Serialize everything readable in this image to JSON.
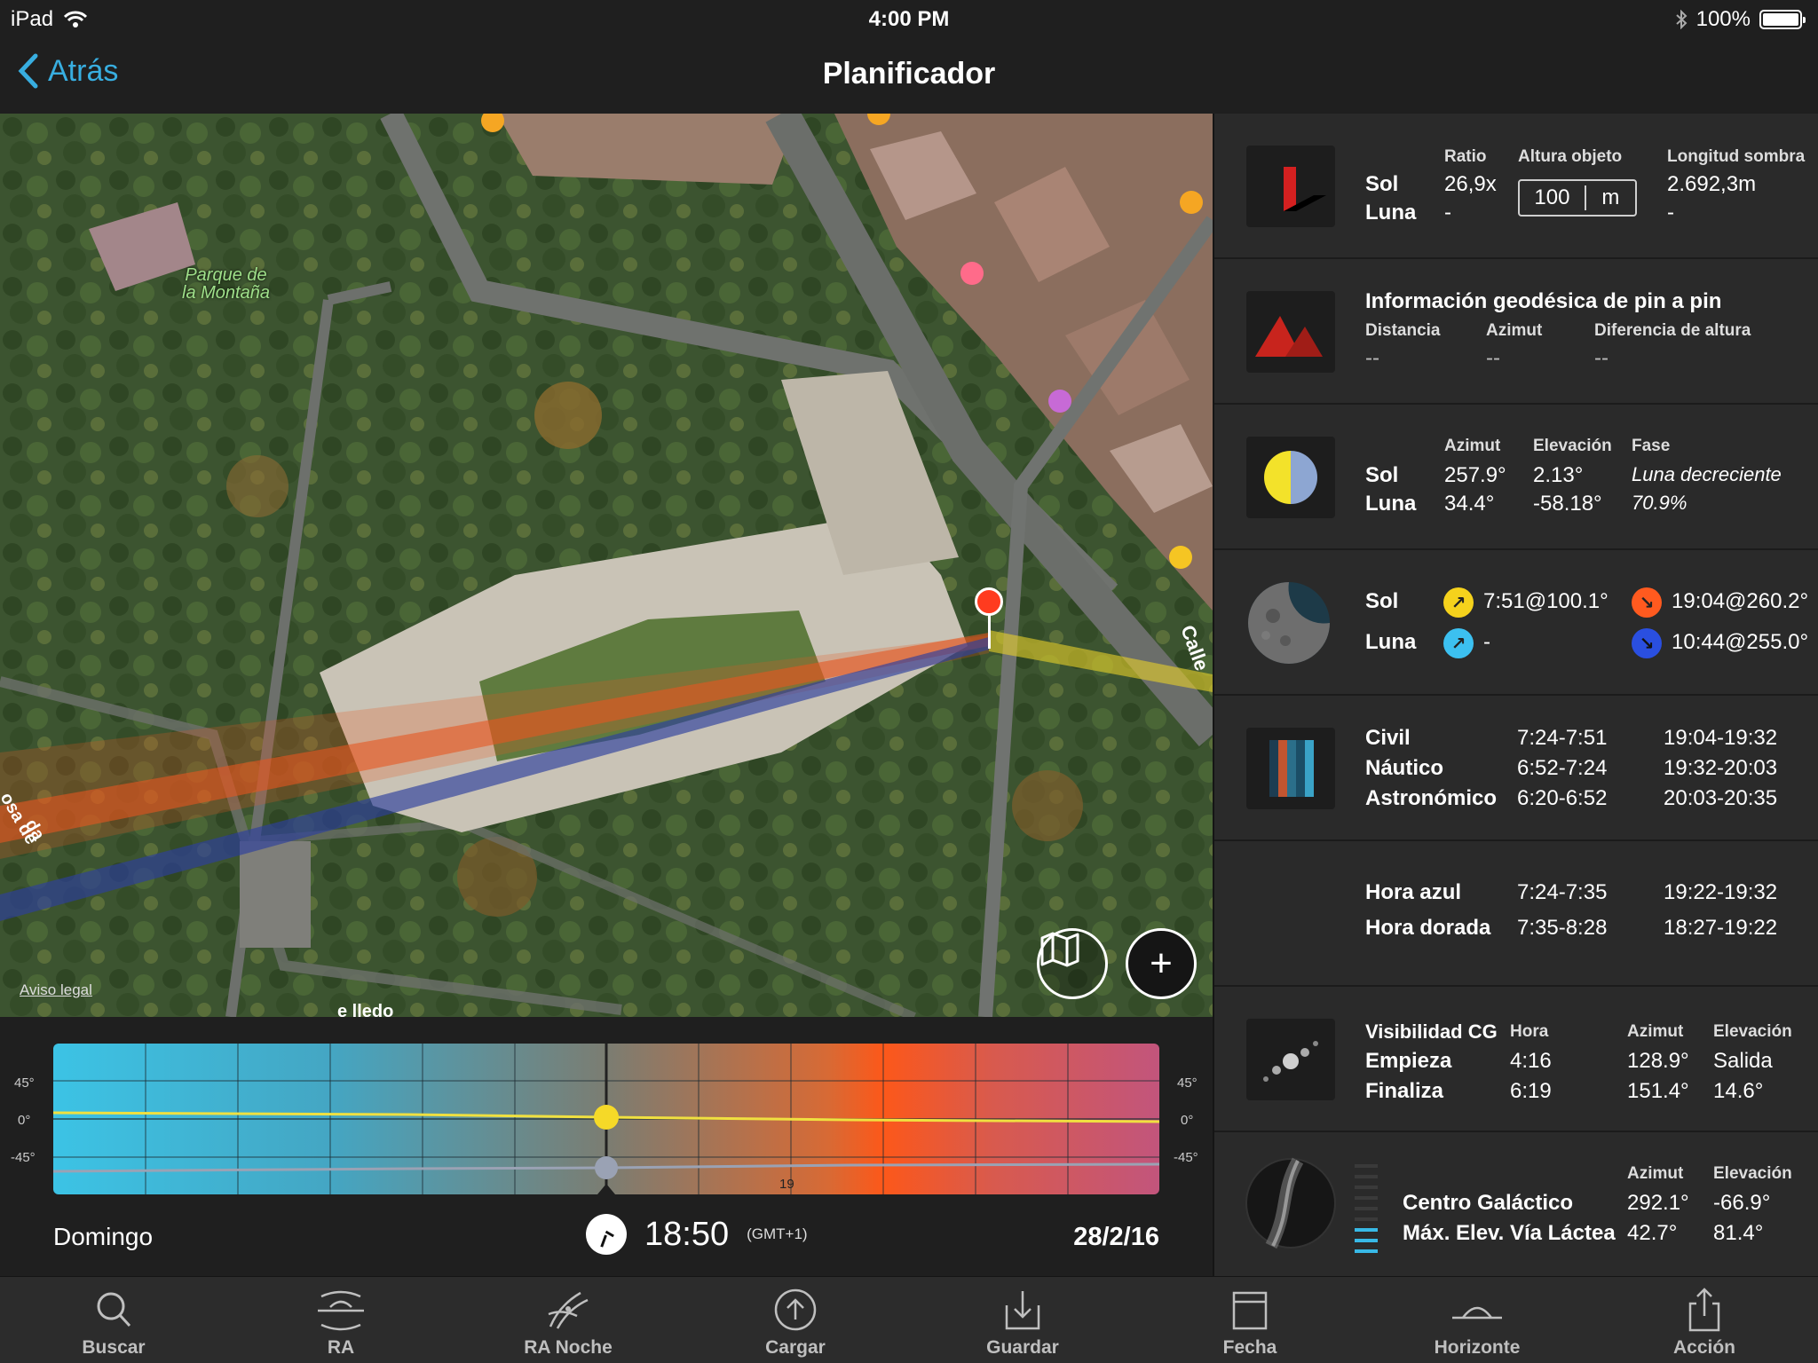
{
  "status": {
    "device": "iPad",
    "time": "4:00 PM",
    "battery": "100%"
  },
  "nav": {
    "back_label": "Atrás",
    "title": "Planificador"
  },
  "map": {
    "park_label_1": "Parque de",
    "park_label_2": "la Montaña",
    "legal": "Aviso legal",
    "street_1": "Calle",
    "street_2": "osa de",
    "street_3": "da",
    "street_4": "e lledo"
  },
  "timeline": {
    "axis": [
      "45°",
      "0°",
      "-45°"
    ],
    "hour_tick": "19",
    "day": "Domingo",
    "time": "18:50",
    "tz": "(GMT+1)",
    "date": "28/2/16",
    "cursor_fraction": 0.5
  },
  "shadow": {
    "sun": "Sol",
    "moon": "Luna",
    "ratio_h": "Ratio",
    "ratio_sun": "26,9x",
    "ratio_moon": "-",
    "height_h": "Altura objeto",
    "height_value": "100",
    "height_unit": "m",
    "length_h": "Longitud sombra",
    "length_sun": "2.692,3m",
    "length_moon": "-"
  },
  "geodesic": {
    "title": "Información geodésica de pin a pin",
    "distance_h": "Distancia",
    "azimuth_h": "Azimut",
    "height_diff_h": "Diferencia de altura",
    "distance": "--",
    "azimuth": "--",
    "height_diff": "--"
  },
  "position": {
    "sun": "Sol",
    "moon": "Luna",
    "azimuth_h": "Azimut",
    "elev_h": "Elevación",
    "phase_h": "Fase",
    "sun_az": "257.9°",
    "sun_el": "2.13°",
    "phase_name": "Luna decreciente",
    "moon_az": "34.4°",
    "moon_el": "-58.18°",
    "phase_pct": "70.9%"
  },
  "rise_set": {
    "sun": "Sol",
    "moon": "Luna",
    "sun_rise": "7:51@100.1°",
    "sun_set": "19:04@260.2°",
    "moon_rise": "-",
    "moon_set": "10:44@255.0°",
    "colors": {
      "sun_rise": "#f5d21c",
      "sun_set": "#ff5a1f",
      "moon_rise": "#3cc0f0",
      "moon_set": "#2a4fe0"
    }
  },
  "twilight": {
    "civil": "Civil",
    "nautical": "Náutico",
    "astro": "Astronómico",
    "civil_am": "7:24-7:51",
    "civil_pm": "19:04-19:32",
    "nautical_am": "6:52-7:24",
    "nautical_pm": "19:32-20:03",
    "astro_am": "6:20-6:52",
    "astro_pm": "20:03-20:35"
  },
  "hours": {
    "blue": "Hora azul",
    "golden": "Hora dorada",
    "blue_am": "7:24-7:35",
    "blue_pm": "19:22-19:32",
    "golden_am": "7:35-8:28",
    "golden_pm": "18:27-19:22"
  },
  "gc_visibility": {
    "title": "Visibilidad CG",
    "hour_h": "Hora",
    "azimuth_h": "Azimut",
    "elev_h": "Elevación",
    "start": "Empieza",
    "end": "Finaliza",
    "start_hour": "4:16",
    "start_az": "128.9°",
    "start_el": "Salida",
    "end_hour": "6:19",
    "end_az": "151.4°",
    "end_el": "14.6°"
  },
  "galactic": {
    "azimuth_h": "Azimut",
    "elev_h": "Elevación",
    "center": "Centro Galáctico",
    "center_az": "292.1°",
    "center_el": "-66.9°",
    "max": "Máx. Elev. Vía Láctea",
    "max_az": "42.7°",
    "max_el": "81.4°"
  },
  "tabs": [
    {
      "label": "Buscar",
      "icon": "search-icon"
    },
    {
      "label": "RA",
      "icon": "ar-icon"
    },
    {
      "label": "RA Noche",
      "icon": "ar-night-icon"
    },
    {
      "label": "Cargar",
      "icon": "load-icon"
    },
    {
      "label": "Guardar",
      "icon": "save-icon"
    },
    {
      "label": "Fecha",
      "icon": "calendar-icon"
    },
    {
      "label": "Horizonte",
      "icon": "horizon-icon"
    },
    {
      "label": "Acción",
      "icon": "share-icon"
    }
  ]
}
